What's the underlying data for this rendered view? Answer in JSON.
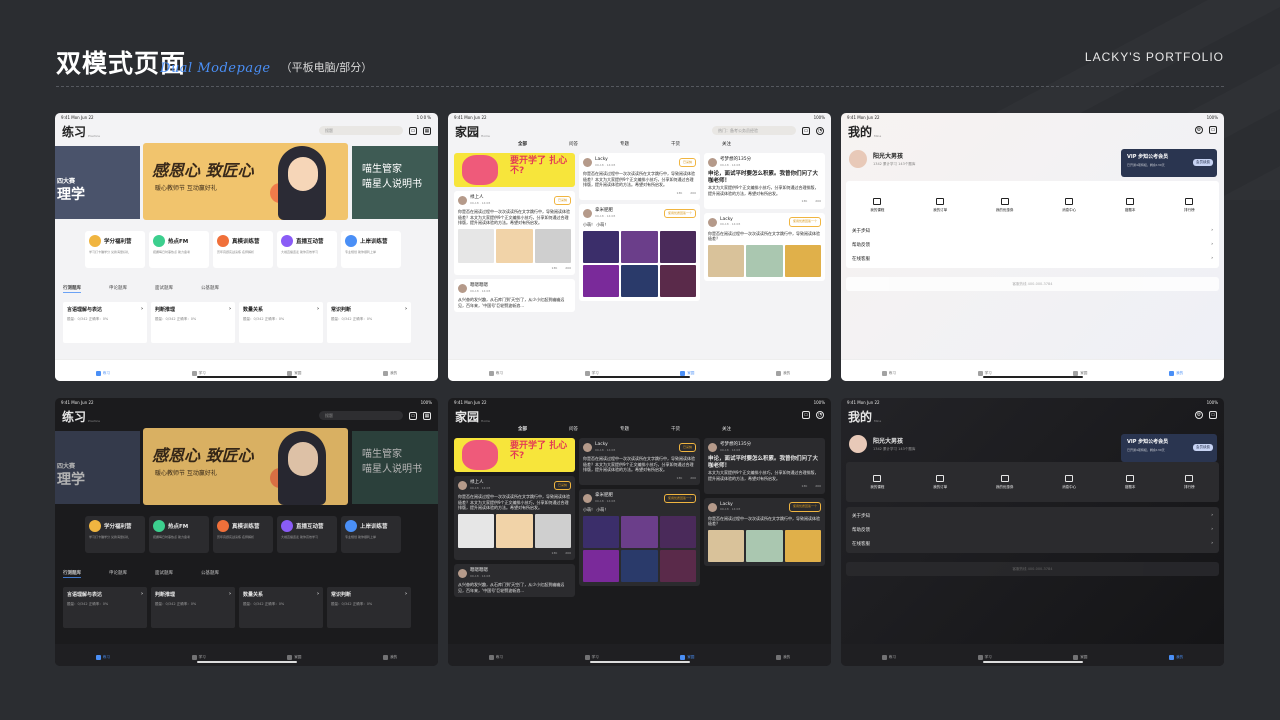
{
  "header": {
    "title": "双模式页面",
    "script": "Dual Modepage",
    "subtitle": "（平板电脑/部分）",
    "brand": "LACKY'S  PORTFOLIO"
  },
  "status": {
    "time": "9:41  Mon Jun 22",
    "battery": "100%"
  },
  "practice": {
    "title": "练习",
    "sub": "Practice",
    "search_placeholder": "搜题",
    "banner_left": [
      "四大赛",
      "理学"
    ],
    "banner_title": "感恩心 致匠心",
    "banner_sub": "暖心教师节  互动赢好礼",
    "banner_right": [
      "喵生管家",
      "喵星人说明书"
    ],
    "quick": [
      {
        "label": "学分福利营",
        "desc": "学习打卡赚学分 兑换海量好礼",
        "color": "#f0b540"
      },
      {
        "label": "热点FM",
        "desc": "把握每日时事热点 助力备考",
        "color": "#3ccf8e"
      },
      {
        "label": "真模训练营",
        "desc": "历年真题实战演练 名师解析",
        "color": "#f0703a"
      },
      {
        "label": "直播互动营",
        "desc": "大咖直播连麦 助你高效学习",
        "color": "#8a5cf6"
      },
      {
        "label": "上岸训练营",
        "desc": "专业规划 助你顺利上岸",
        "color": "#4a8ff6"
      }
    ],
    "tabs": [
      "行测题库",
      "申论题库",
      "面试题库",
      "公基题库"
    ],
    "cards": [
      {
        "title": "言语理解与表达",
        "stats": "题量：0/342    正确率：0%"
      },
      {
        "title": "判断推理",
        "stats": "题量：0/342    正确率：0%"
      },
      {
        "title": "数量关系",
        "stats": "题量：0/342    正确率：0%"
      },
      {
        "title": "常识判断",
        "stats": "题量：0/342    正确率：0%"
      }
    ]
  },
  "home": {
    "title": "家园",
    "sub": "Home",
    "search_placeholder": "热门：备考公务员经验",
    "tabs": [
      "全部",
      "问答",
      "专题",
      "干货",
      "关注"
    ],
    "yellow_post": "要开学了 扎心不?",
    "posts": [
      {
        "user": "禄上人",
        "date": "09-18 · 14:08",
        "tag": "已采纳",
        "text": "你是否在阅读过程中一次次读读所在文字跳行中，导致阅读体验极差？本文为大家提供9个正文编排小技巧，分享如何通过合理排版，提升阅读体验的方法。希望对有所启发。",
        "likes": "13K",
        "comments": "200"
      },
      {
        "user": "嗯嗯嗯嗯",
        "date": "09-18 · 14:08",
        "tag": "",
        "text": "从兴奋的发兴趣，从石库门到'天空门'，从少小红起到幽幽远见，百年来，'中国号'巨轮劈波斩浪..."
      },
      {
        "user": "Lacky",
        "date": "09-18 · 14:08",
        "tag": "已采纳",
        "text": "你是否在阅读过程中一次次读读所在文字跳行中，导致阅读体验极差？本文为大家提供9个正文编排小技巧，分享如何通过合理排版，提升阅读体验的方法。希望对有所启发。",
        "likes": "13K",
        "comments": "200"
      },
      {
        "user": "拿米肥肥",
        "date": "09-18 · 14:08",
        "tag": "使用优质回答一个",
        "text": "小萌！ 小萌！",
        "likes": "13K",
        "comments": "200"
      },
      {
        "user": "考梦想的135分",
        "date": "09-18 · 14:08",
        "tag": "",
        "q": "申论，面试平时要怎么积累。我曾你们问了大咖老师！",
        "text": "本文为大家提供9个正文编排小技巧，分享如何通过合理排版，提升阅读体验的方法，希望对有所启发。",
        "tag2": "干货",
        "likes": "13K",
        "comments": "200"
      },
      {
        "user": "Lacky",
        "date": "09-18 · 14:08",
        "tag": "使用优质回答一个",
        "text": "你是否在阅读过程中一次次读读所在文字跳行中，导致阅读体验极差？"
      }
    ]
  },
  "mine": {
    "title": "我的",
    "sub": "Mine",
    "name": "阳光大男孩",
    "stats": "1342 累计学习    143个题库",
    "vip_title": "VIP 步知公考会员",
    "vip_sub": "已开通4项特权，剩余130天",
    "vip_btn": "会员续费",
    "items": [
      "我的课程",
      "我的订单",
      "我的优惠券",
      "消息中心",
      "错题本",
      "排行榜"
    ],
    "menu": [
      "关于步知",
      "帮助反馈",
      "在线客服"
    ],
    "hotline": "客服热线 400-000-3784"
  },
  "tabbar": [
    "练习",
    "学习",
    "家园",
    "我的"
  ]
}
